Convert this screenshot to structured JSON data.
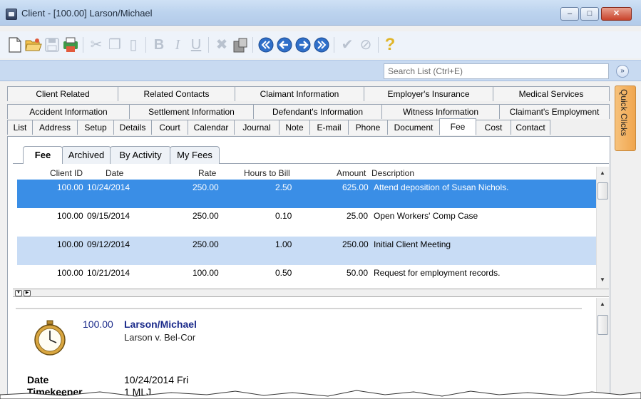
{
  "window": {
    "title": "Client - [100.00] Larson/Michael",
    "min_label": "–",
    "max_label": "□",
    "close_label": "✕"
  },
  "toolbar": {
    "buttons": [
      "new-document",
      "open-folder",
      "save",
      "print",
      "cut",
      "copy",
      "paste",
      "bold",
      "italic",
      "underline",
      "delete",
      "attach",
      "first-record",
      "previous-record",
      "next-record",
      "last-record",
      "check",
      "cancel",
      "help"
    ]
  },
  "search": {
    "placeholder": "Search List (Ctrl+E)",
    "collapse_label": "»"
  },
  "tabs": {
    "row1": [
      "Client Related",
      "Related Contacts",
      "Claimant Information",
      "Employer's Insurance",
      "Medical Services"
    ],
    "row2": [
      "Accident Information",
      "Settlement Information",
      "Defendant's Information",
      "Witness Information",
      "Claimant's Employment"
    ],
    "row3": [
      "List",
      "Address",
      "Setup",
      "Details",
      "Court",
      "Calendar",
      "Journal",
      "Note",
      "E-mail",
      "Phone",
      "Document",
      "Fee",
      "Cost",
      "Contact"
    ],
    "active": "Fee"
  },
  "quick_clicks": "Quick Clicks",
  "subtabs": [
    "Fee",
    "Archived",
    "By Activity",
    "My Fees"
  ],
  "fee_list": {
    "columns": [
      "Client ID",
      "Date",
      "Rate",
      "Hours to Bill",
      "Amount",
      "Description"
    ],
    "rows": [
      {
        "client_id": "100.00",
        "date": "10/24/2014",
        "rate": "250.00",
        "hours": "2.50",
        "amount": "625.00",
        "description": "Attend deposition of Susan Nichols."
      },
      {
        "client_id": "100.00",
        "date": "09/15/2014",
        "rate": "250.00",
        "hours": "0.10",
        "amount": "25.00",
        "description": "Open Workers' Comp Case"
      },
      {
        "client_id": "100.00",
        "date": "09/12/2014",
        "rate": "250.00",
        "hours": "1.00",
        "amount": "250.00",
        "description": "Initial Client Meeting"
      },
      {
        "client_id": "100.00",
        "date": "10/21/2014",
        "rate": "100.00",
        "hours": "0.50",
        "amount": "50.00",
        "description": "Request for employment records."
      }
    ]
  },
  "detail": {
    "client_id": "100.00",
    "client_name": "Larson/Michael",
    "case_name": "Larson v. Bel-Cor",
    "date_label": "Date",
    "date_value": "10/24/2014  Fri",
    "timekeeper_label": "Timekeeper",
    "timekeeper_value": "1  MLJ"
  },
  "colors": {
    "selected_row": "#3a8ee6",
    "alt_row": "#c8dcf5",
    "quick_clicks": "#f0a54e",
    "detail_text": "#1a2a8a"
  }
}
